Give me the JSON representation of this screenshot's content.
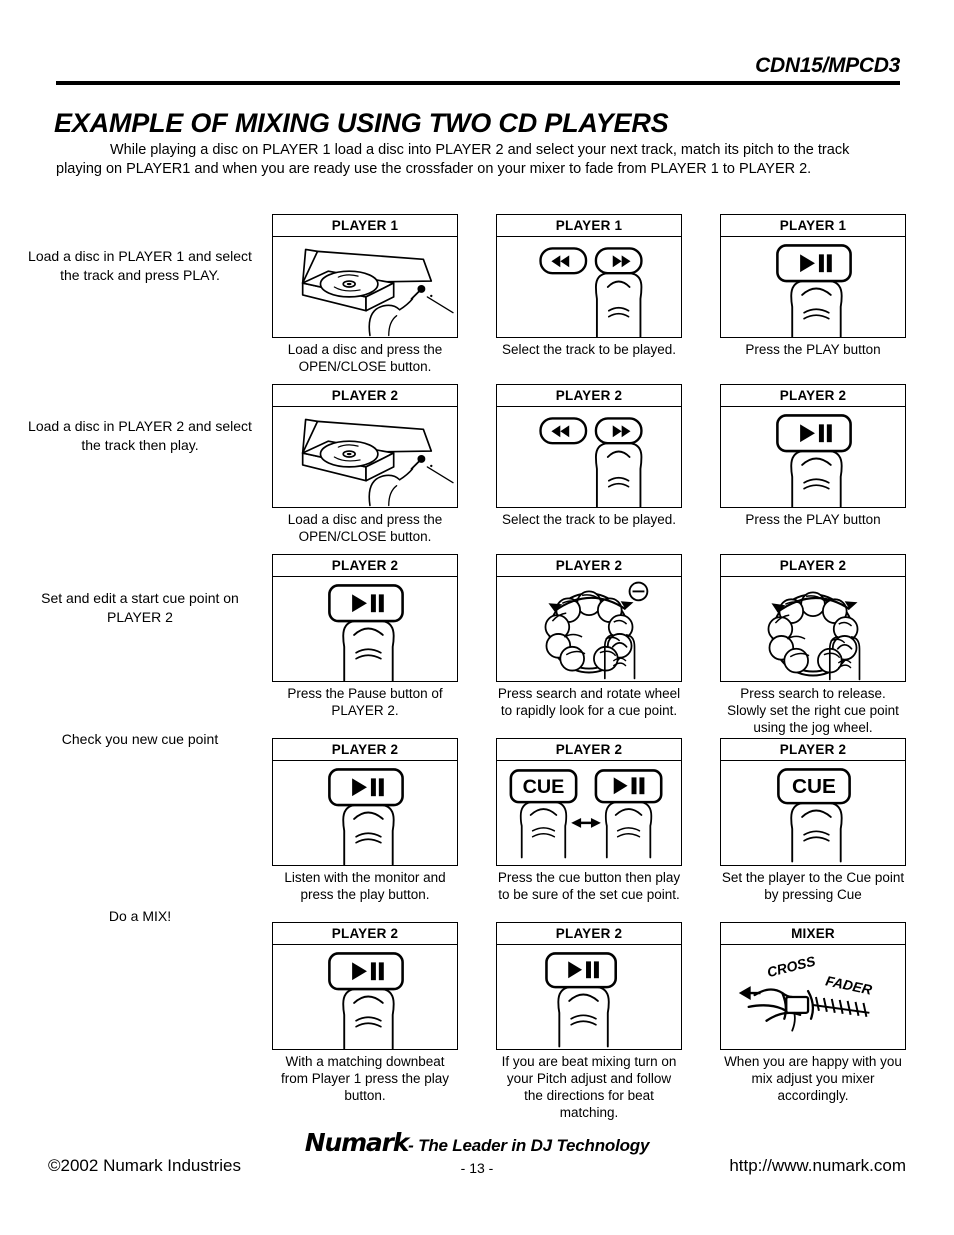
{
  "header": {
    "doc_code": "CDN15/MPCD3",
    "title": "EXAMPLE OF MIXING USING TWO CD PLAYERS",
    "intro": "While playing a disc on PLAYER 1 load a disc into PLAYER 2 and select your next track, match its pitch to the track playing on PLAYER1 and when you are ready use the crossfader on your mixer to fade from PLAYER 1 to PLAYER 2."
  },
  "rows": [
    {
      "description": "Load a disc in PLAYER 1 and select the track and press PLAY.",
      "cells": [
        {
          "title": "PLAYER 1",
          "caption": "Load a disc and press the OPEN/CLOSE button.",
          "art": "cd-tray-hand"
        },
        {
          "title": "PLAYER 1",
          "caption": "Select the track to be played.",
          "art": "search-buttons-finger",
          "buttons": [
            "rewind-icon",
            "fast-forward-icon"
          ]
        },
        {
          "title": "PLAYER 1",
          "caption": "Press the PLAY button",
          "art": "play-button-finger",
          "buttons": [
            "play-pause-icon"
          ]
        }
      ]
    },
    {
      "description": "Load a disc in PLAYER 2 and select the track then play.",
      "cells": [
        {
          "title": "PLAYER 2",
          "caption": "Load a disc and press the OPEN/CLOSE button.",
          "art": "cd-tray-hand"
        },
        {
          "title": "PLAYER 2",
          "caption": "Select the track to be played.",
          "art": "search-buttons-finger",
          "buttons": [
            "rewind-icon",
            "fast-forward-icon"
          ]
        },
        {
          "title": "PLAYER 2",
          "caption": "Press the PLAY button",
          "art": "play-button-finger",
          "buttons": [
            "play-pause-icon"
          ]
        }
      ]
    },
    {
      "description": "Set and edit a start cue point on PLAYER 2",
      "cells": [
        {
          "title": "PLAYER 2",
          "caption": "Press the Pause button of PLAYER 2.",
          "art": "play-button-finger",
          "buttons": [
            "play-pause-icon"
          ]
        },
        {
          "title": "PLAYER 2",
          "caption": "Press search and rotate wheel to rapidly look for a cue point.",
          "art": "jog-wheel-spin-minus"
        },
        {
          "title": "PLAYER 2",
          "caption": "Press search to release. Slowly set the right cue point using the jog wheel.",
          "art": "jog-wheel-spin"
        }
      ]
    },
    {
      "description": "Check you new cue point",
      "cells": [
        {
          "title": "PLAYER 2",
          "caption": "Listen with the monitor and press the play button.",
          "art": "play-button-finger",
          "buttons": [
            "play-pause-icon"
          ]
        },
        {
          "title": "PLAYER 2",
          "caption": "Press the cue button then play to be sure of the set cue point.",
          "art": "cue-and-play-fingers",
          "buttons": [
            "CUE",
            "play-pause-icon"
          ]
        },
        {
          "title": "PLAYER 2",
          "caption": "Set the player to the Cue point by pressing Cue",
          "art": "cue-button-finger",
          "buttons": [
            "CUE"
          ]
        }
      ]
    },
    {
      "description": "Do a MIX!",
      "cells": [
        {
          "title": "PLAYER 2",
          "caption": "With a matching downbeat from Player 1 press the play button.",
          "art": "play-button-finger",
          "buttons": [
            "play-pause-icon"
          ]
        },
        {
          "title": "PLAYER 2",
          "caption": "If you are beat mixing turn on your Pitch adjust and follow the directions for beat matching.",
          "art": "play-button-finger",
          "buttons": [
            "play-pause-icon"
          ]
        },
        {
          "title": "MIXER",
          "caption": "When you are happy with you mix adjust you mixer accordingly.",
          "art": "crossfader-hand",
          "label": "CROSS FADER"
        }
      ]
    }
  ],
  "footer": {
    "brand_name": "Numark",
    "brand_tagline": "- The Leader in DJ Technology",
    "copyright": "©2002 Numark Industries",
    "page_number": "- 13 -",
    "website": "http://www.numark.com"
  }
}
